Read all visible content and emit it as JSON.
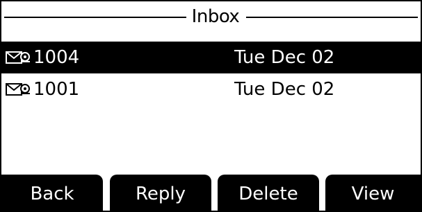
{
  "title": "Inbox",
  "messages": [
    {
      "name": "1004",
      "date": "Tue Dec 02",
      "selected": true,
      "icon": "message-envelope-icon"
    },
    {
      "name": "1001",
      "date": "Tue Dec 02",
      "selected": false,
      "icon": "message-envelope-icon"
    }
  ],
  "softkeys": [
    "Back",
    "Reply",
    "Delete",
    "View"
  ],
  "colors": {
    "background": "#ffffff",
    "foreground": "#000000",
    "highlight": "#000000"
  }
}
